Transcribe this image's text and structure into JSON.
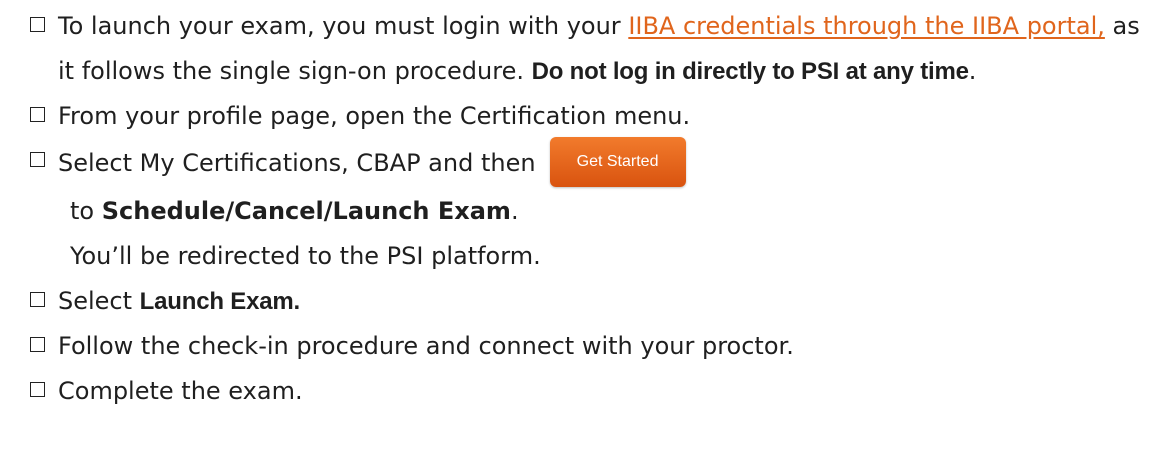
{
  "colors": {
    "link": "#e0651c",
    "button": "#e86a22",
    "text": "#1f1f1f"
  },
  "steps": [
    {
      "text_before": "To launch your exam, you must login with your ",
      "link_text": "IIBA credentials through the IIBA portal,",
      "text_after": " as it follows the single sign-on procedure.  ",
      "bold_text": "Do not log in directly to PSI at any time",
      "end": "."
    },
    {
      "text": "From your profile page, open the Certification menu."
    },
    {
      "text_before": "Select My Certifications, CBAP and then",
      "button_label": "Get Started",
      "line2_before": "to ",
      "line2_bold": "Schedule/Cancel/Launch Exam",
      "line2_end": ".",
      "line3": "You’ll be redirected to the PSI platform."
    },
    {
      "text_before": "Select ",
      "bold_text": "Launch Exam."
    },
    {
      "text": "Follow the check-in procedure and connect with your proctor."
    },
    {
      "text": "Complete the exam."
    }
  ]
}
